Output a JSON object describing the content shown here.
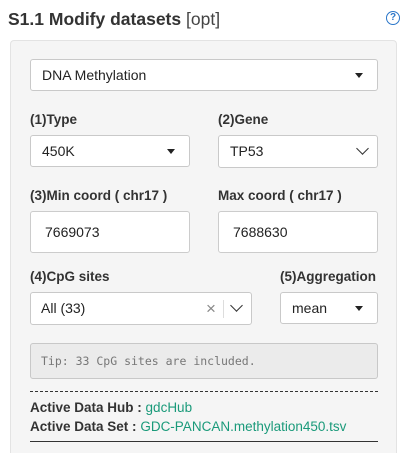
{
  "header": {
    "title": "S1.1 Modify datasets",
    "opt_tag": "[opt]",
    "help_icon": "question-circle-icon"
  },
  "colors": {
    "panel_bg": "#f5f5f5",
    "link": "#1a9a7a",
    "help_icon": "#2a76c9"
  },
  "dataset_select": {
    "value": "DNA Methylation"
  },
  "type": {
    "label": "(1)Type",
    "value": "450K"
  },
  "gene": {
    "label": "(2)Gene",
    "value": "TP53"
  },
  "min_coord": {
    "label": "(3)Min coord ( chr17 )",
    "value": "7669073"
  },
  "max_coord": {
    "label": "Max coord ( chr17 )",
    "value": "7688630"
  },
  "cpg": {
    "label": "(4)CpG sites",
    "value": "All (33)"
  },
  "aggregation": {
    "label": "(5)Aggregation",
    "value": "mean"
  },
  "tip": "Tip: 33 CpG sites are included.",
  "active_hub": {
    "label": "Active Data Hub :",
    "value": "gdcHub"
  },
  "active_set": {
    "label": "Active Data Set :",
    "value": "GDC-PANCAN.methylation450.tsv"
  }
}
